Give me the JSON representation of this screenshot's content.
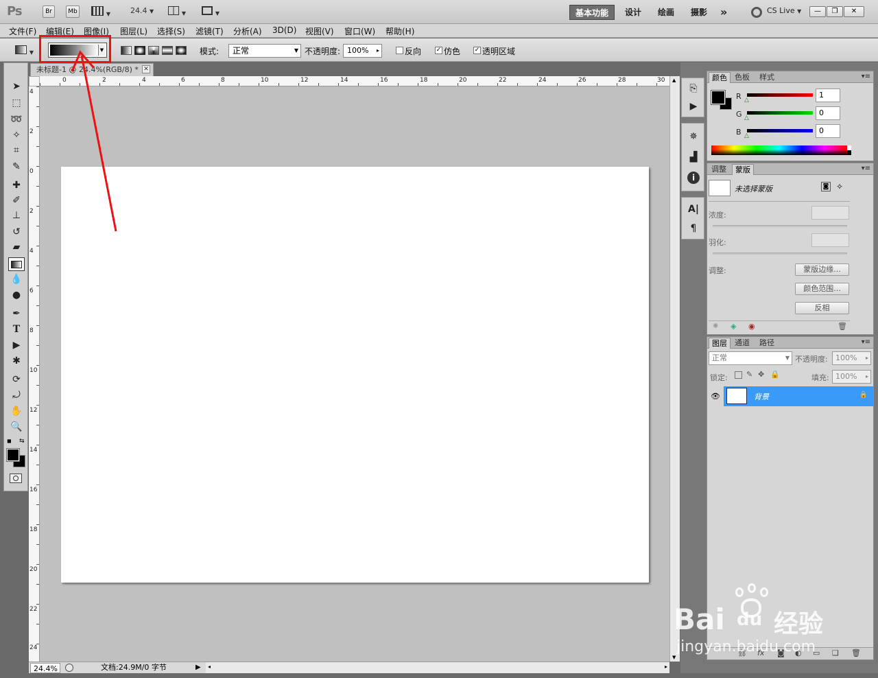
{
  "app": {
    "logo": "Ps",
    "bridge_btn": "Br",
    "minibridge_btn": "Mb",
    "zoom_display": "24.4",
    "workspaces": [
      "基本功能",
      "设计",
      "绘画",
      "摄影"
    ],
    "workspace_more": "»",
    "cslive": "CS Live",
    "window_controls": [
      "—",
      "❐",
      "✕"
    ]
  },
  "menu": [
    "文件(F)",
    "编辑(E)",
    "图像(I)",
    "图层(L)",
    "选择(S)",
    "滤镜(T)",
    "分析(A)",
    "3D(D)",
    "视图(V)",
    "窗口(W)",
    "帮助(H)"
  ],
  "options": {
    "mode_label": "模式:",
    "mode_value": "正常",
    "opacity_label": "不透明度:",
    "opacity_value": "100%",
    "reverse_label": "反向",
    "reverse_checked": false,
    "dither_label": "仿色",
    "dither_checked": true,
    "transparency_label": "透明区域",
    "transparency_checked": true
  },
  "document": {
    "tab_title": "未标题-1 @ 24.4%(RGB/8) *",
    "status_zoom": "24.4%",
    "status_doc": "文档:24.9M/0 字节",
    "ruler_h": [
      "0",
      "2",
      "4",
      "6",
      "8",
      "10",
      "12",
      "14",
      "16",
      "18",
      "20",
      "22",
      "24",
      "26",
      "28",
      "30"
    ],
    "ruler_v": [
      "4",
      "2",
      "0",
      "2",
      "4",
      "6",
      "8",
      "10",
      "12",
      "14",
      "16",
      "18",
      "20",
      "22",
      "24"
    ]
  },
  "color_panel": {
    "tabs": [
      "颜色",
      "色板",
      "样式"
    ],
    "channels": [
      {
        "label": "R",
        "value": "1",
        "color": "#d40000"
      },
      {
        "label": "G",
        "value": "0",
        "color": "#00b400"
      },
      {
        "label": "B",
        "value": "0",
        "color": "#0000d4"
      }
    ]
  },
  "mask_panel": {
    "tabs": [
      "调整",
      "蒙版"
    ],
    "no_mask": "未选择蒙版",
    "density_label": "浓度:",
    "feather_label": "羽化:",
    "refine_label": "调整:",
    "mask_edge_btn": "蒙版边缘...",
    "color_range_btn": "颜色范围...",
    "invert_btn": "反相"
  },
  "layers_panel": {
    "tabs": [
      "图层",
      "通道",
      "路径"
    ],
    "blend_mode": "正常",
    "opacity_label": "不透明度:",
    "opacity_value": "100%",
    "lock_label": "锁定:",
    "fill_label": "填充:",
    "fill_value": "100%",
    "layer_name": "背景"
  },
  "watermark": {
    "brand": "Bai",
    "brand2": "du",
    "service": "经验",
    "url": "jingyan.baidu.com"
  },
  "colors": {
    "highlight_red": "#ee1111",
    "layer_selected": "#3a9af7"
  }
}
